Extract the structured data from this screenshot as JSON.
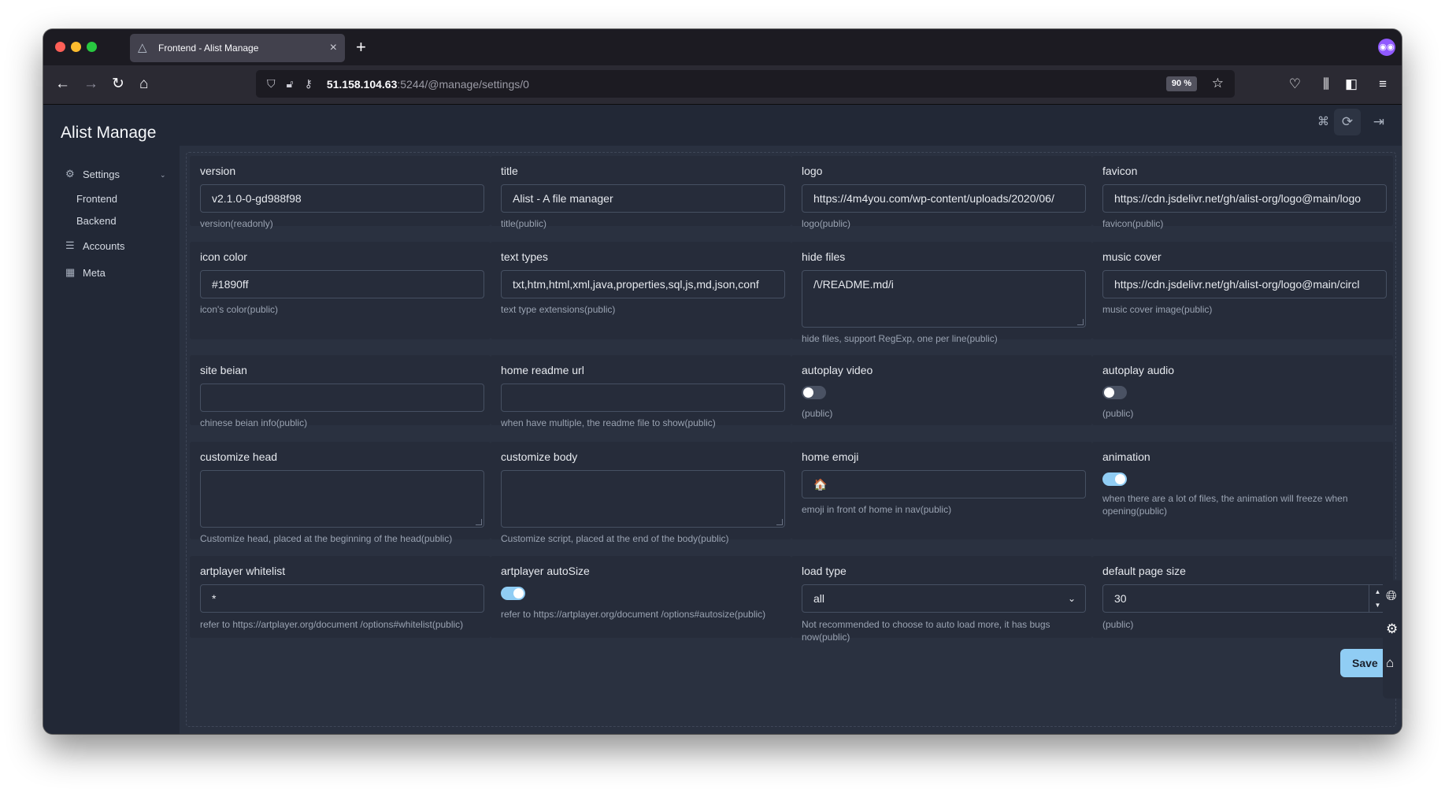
{
  "browser": {
    "tab_title": "Frontend - Alist Manage",
    "url_host": "51.158.104.63",
    "url_path": ":5244/@manage/settings/0",
    "zoom": "90 %"
  },
  "sidebar": {
    "brand": "Alist Manage",
    "settings_label": "Settings",
    "frontend_label": "Frontend",
    "backend_label": "Backend",
    "accounts_label": "Accounts",
    "meta_label": "Meta"
  },
  "fields": {
    "version": {
      "label": "version",
      "value": "v2.1.0-0-gd988f98",
      "help": "version(readonly)"
    },
    "title": {
      "label": "title",
      "value": "Alist - A file manager",
      "help": "title(public)"
    },
    "logo": {
      "label": "logo",
      "value": "https://4m4you.com/wp-content/uploads/2020/06/",
      "help": "logo(public)"
    },
    "favicon": {
      "label": "favicon",
      "value": "https://cdn.jsdelivr.net/gh/alist-org/logo@main/logo",
      "help": "favicon(public)"
    },
    "icon_color": {
      "label": "icon color",
      "value": "#1890ff",
      "help": "icon's color(public)"
    },
    "text_types": {
      "label": "text types",
      "value": "txt,htm,html,xml,java,properties,sql,js,md,json,conf",
      "help": "text type extensions(public)"
    },
    "hide_files": {
      "label": "hide files",
      "value": "/\\/README.md/i",
      "help": "hide files, support RegExp, one per line(public)"
    },
    "music_cover": {
      "label": "music cover",
      "value": "https://cdn.jsdelivr.net/gh/alist-org/logo@main/circl",
      "help": "music cover image(public)"
    },
    "site_beian": {
      "label": "site beian",
      "value": "",
      "help": "chinese beian info(public)"
    },
    "home_readme_url": {
      "label": "home readme url",
      "value": "",
      "help": "when have multiple, the readme file to show(public)"
    },
    "autoplay_video": {
      "label": "autoplay video",
      "enabled": false,
      "help": "(public)"
    },
    "autoplay_audio": {
      "label": "autoplay audio",
      "enabled": false,
      "help": "(public)"
    },
    "customize_head": {
      "label": "customize head",
      "value": "",
      "help": "Customize head, placed at the beginning of the head(public)"
    },
    "customize_body": {
      "label": "customize body",
      "value": "",
      "help": "Customize script, placed at the end of the body(public)"
    },
    "home_emoji": {
      "label": "home emoji",
      "value": "🏠",
      "help": "emoji in front of home in nav(public)"
    },
    "animation": {
      "label": "animation",
      "enabled": true,
      "help": "when there are a lot of files, the animation will freeze when opening(public)"
    },
    "artplayer_whitelist": {
      "label": "artplayer whitelist",
      "value": "*",
      "help": "refer to https://artplayer.org/document /options#whitelist(public)"
    },
    "artplayer_autosize": {
      "label": "artplayer autoSize",
      "enabled": true,
      "help": "refer to https://artplayer.org/document /options#autosize(public)"
    },
    "load_type": {
      "label": "load type",
      "value": "all",
      "help": "Not recommended to choose to auto load more, it has bugs now(public)"
    },
    "default_page_size": {
      "label": "default page size",
      "value": "30",
      "help": "(public)"
    }
  },
  "save_label": "Save",
  "colors": {
    "accent": "#90cdf4",
    "background": "#2a3140",
    "sidebar": "#222836"
  },
  "icons": [
    "settings-gear-icon",
    "accounts-list-icon",
    "meta-icon",
    "github-icon",
    "refresh-icon",
    "logout-icon",
    "globe-icon",
    "gear-icon",
    "home-icon"
  ]
}
